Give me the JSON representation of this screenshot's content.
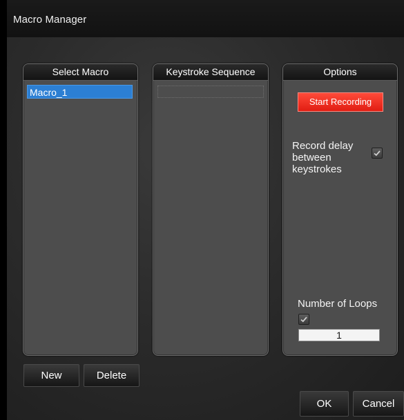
{
  "window": {
    "title": "Macro Manager"
  },
  "panels": {
    "select_macro": {
      "title": "Select Macro",
      "items": [
        "Macro_1"
      ],
      "selected": "Macro_1"
    },
    "keystroke_sequence": {
      "title": "Keystroke Sequence"
    },
    "options": {
      "title": "Options",
      "start_recording_label": "Start Recording",
      "record_delay_label": "Record delay between keystrokes",
      "record_delay_checked": true,
      "number_of_loops_label": "Number of Loops",
      "number_of_loops_checked": true,
      "number_of_loops_value": "1"
    }
  },
  "buttons": {
    "new_label": "New",
    "delete_label": "Delete",
    "ok_label": "OK",
    "cancel_label": "Cancel"
  },
  "colors": {
    "selection_blue": "#2c7fd3",
    "record_red": "#e11d12",
    "panel_gray": "#4d4d4d",
    "titlebar_dark": "#121212"
  },
  "icons": {
    "checkmark": "check-icon"
  }
}
